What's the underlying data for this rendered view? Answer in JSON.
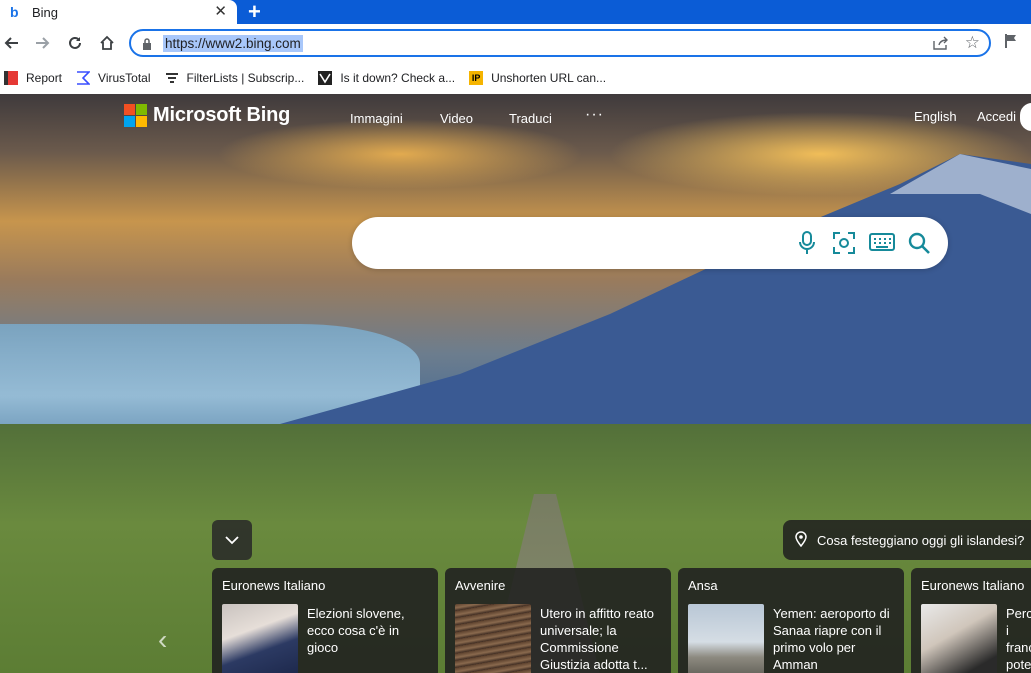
{
  "browser": {
    "tab_title": "Bing",
    "new_tab": "+",
    "url": "https://www2.bing.com"
  },
  "bookmarks": [
    {
      "label": "Report",
      "icon": "report-icon"
    },
    {
      "label": "VirusTotal",
      "icon": "virustotal-icon"
    },
    {
      "label": "FilterLists | Subscrip...",
      "icon": "filterlists-icon"
    },
    {
      "label": "Is it down? Check a...",
      "icon": "isitdown-icon"
    },
    {
      "label": "Unshorten URL can...",
      "icon": "ip-icon"
    }
  ],
  "bing": {
    "logo_text": "Microsoft Bing",
    "nav": [
      "Immagini",
      "Video",
      "Traduci"
    ],
    "more": "···",
    "language": "English",
    "signin": "Accedi",
    "trivia": "Cosa festeggiano oggi gli islandesi?",
    "news": [
      {
        "source": "Euronews Italiano",
        "headline": "Elezioni slovene, ecco cosa c'è in gioco"
      },
      {
        "source": "Avvenire",
        "headline": "Utero in affitto reato universale; la Commissione Giustizia adotta t..."
      },
      {
        "source": "Ansa",
        "headline": "Yemen: aeroporto di Sanaa riapre con il primo volo per Amman"
      },
      {
        "source": "Euronews Italiano",
        "headline": "Perché i franc... potere..."
      }
    ]
  },
  "colors": {
    "browser_accent": "#0b5cd6",
    "omnibox_border": "#1a73e8",
    "url_selection": "#a8c7fa",
    "bing_icon_teal": "#168a9a"
  }
}
